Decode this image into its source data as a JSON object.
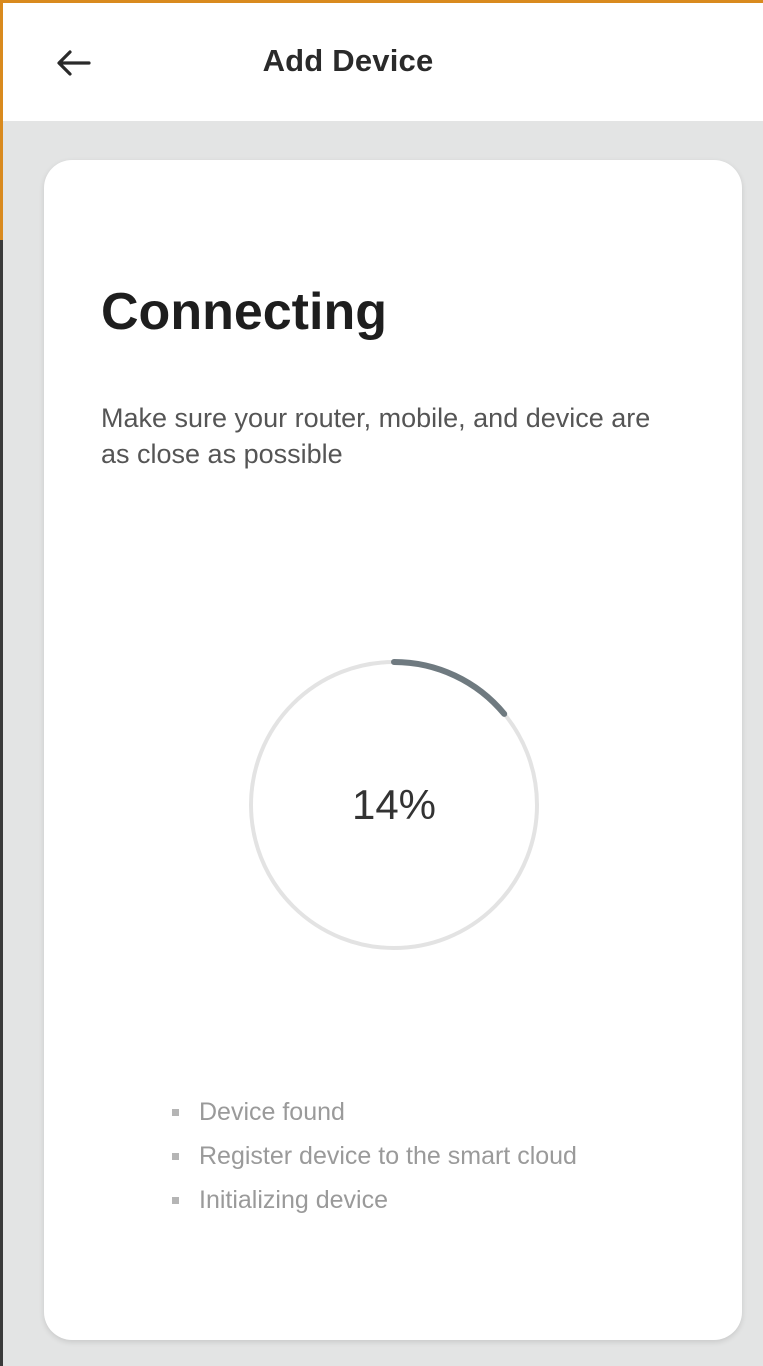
{
  "header": {
    "back_icon": "arrow-left-icon",
    "title": "Add Device"
  },
  "main": {
    "heading": "Connecting",
    "subtext": "Make sure your router, mobile, and device are as close as possible",
    "progress": {
      "percent": 14,
      "label": "14%"
    },
    "steps": [
      {
        "label": "Device found"
      },
      {
        "label": "Register device to the smart cloud"
      },
      {
        "label": "Initializing device"
      }
    ]
  },
  "colors": {
    "progress_arc": "#6f7a80",
    "progress_track": "#e3e3e3",
    "accent_edge": "#d98a1e"
  }
}
